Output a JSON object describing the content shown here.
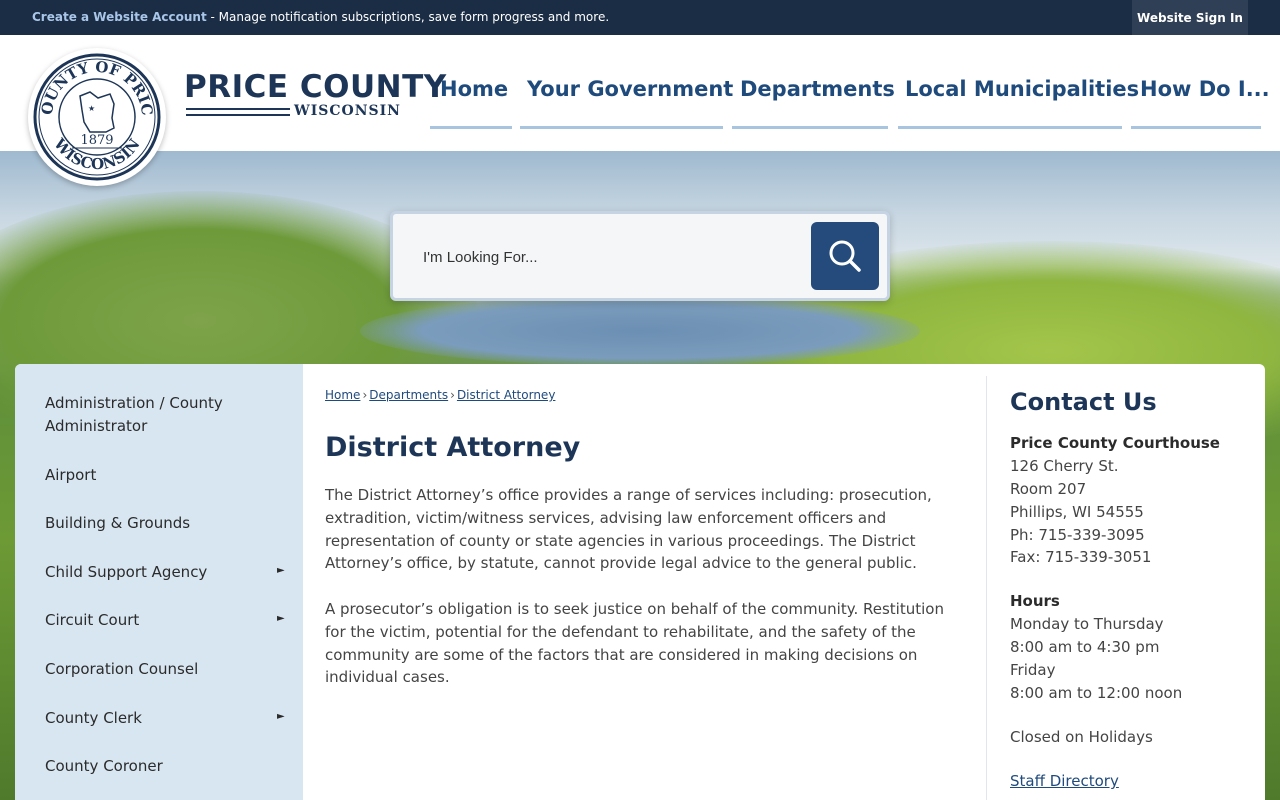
{
  "topbar": {
    "create_link": "Create a Website Account",
    "create_text": " - Manage notification subscriptions, save form progress and more.",
    "sign_in": "Website Sign In"
  },
  "seal": {
    "top_text": "COUNTY OF PRICE",
    "bottom_text": "WISCONSIN",
    "year": "1879"
  },
  "brand": {
    "name": "PRICE COUNTY",
    "state": "WISCONSIN"
  },
  "nav": {
    "items": [
      {
        "label": "Home"
      },
      {
        "label": "Your Government"
      },
      {
        "label": "Departments"
      },
      {
        "label": "Local Municipalities"
      },
      {
        "label": "How Do I..."
      }
    ]
  },
  "search": {
    "placeholder": "I'm Looking For..."
  },
  "sidebar": {
    "items": [
      {
        "label": "Administration / County Administrator",
        "has_submenu": false
      },
      {
        "label": "Airport",
        "has_submenu": false
      },
      {
        "label": "Building & Grounds",
        "has_submenu": false
      },
      {
        "label": "Child Support Agency",
        "has_submenu": true
      },
      {
        "label": "Circuit Court",
        "has_submenu": true
      },
      {
        "label": "Corporation Counsel",
        "has_submenu": false
      },
      {
        "label": "County Clerk",
        "has_submenu": true
      },
      {
        "label": "County Coroner",
        "has_submenu": false
      }
    ],
    "arrow": "►"
  },
  "breadcrumb": {
    "items": [
      "Home",
      "Departments",
      "District Attorney"
    ],
    "separator": "›"
  },
  "page": {
    "title": "District Attorney",
    "paragraphs": [
      "The District Attorney’s office provides a range of services including: prosecution, extradition, victim/witness services, advising law enforcement officers and representation of county or state agencies in various proceedings. The District Attorney’s office, by statute, cannot provide legal advice to the general public.",
      "A prosecutor’s obligation is to seek justice on behalf of the community. Restitution for the victim, potential for the defendant to rehabilitate, and the safety of the community are some of the factors that are considered in making decisions on individual cases."
    ]
  },
  "contact": {
    "heading": "Contact Us",
    "org": "Price County Courthouse",
    "address": [
      "126 Cherry St.",
      "Room 207",
      "Phillips, WI 54555"
    ],
    "phone": "Ph: 715-339-3095",
    "fax": "Fax: 715-339-3051",
    "hours_heading": "Hours",
    "hours": [
      "Monday to Thursday",
      "8:00 am to 4:30 pm",
      "Friday",
      "8:00 am to 12:00 noon"
    ],
    "closed": "Closed on Holidays",
    "staff_link": "Staff Directory"
  },
  "colors": {
    "topbar": "#1b2d45",
    "brand_navy": "#1d3557",
    "nav_blue": "#1f4a7c",
    "search_button": "#244b7c",
    "sidebar_bg": "#d8e6f2"
  }
}
